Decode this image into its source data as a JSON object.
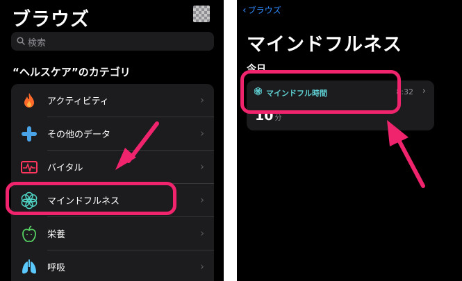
{
  "left": {
    "title": "ブラウズ",
    "search_placeholder": "検索",
    "section_header": "“ヘルスケア”のカテゴリ",
    "categories": [
      {
        "label": "アクティビティ",
        "icon": "flame-icon",
        "color": "#ff6a2a"
      },
      {
        "label": "その他のデータ",
        "icon": "plus-icon",
        "color": "#4aa3e6"
      },
      {
        "label": "バイタル",
        "icon": "heart-rate-icon",
        "color": "#ff375f"
      },
      {
        "label": "マインドフルネス",
        "icon": "mindfulness-icon",
        "color": "#4fd3c4"
      },
      {
        "label": "栄養",
        "icon": "apple-icon",
        "color": "#56d364"
      },
      {
        "label": "呼吸",
        "icon": "lungs-icon",
        "color": "#5ac8fa"
      }
    ]
  },
  "right": {
    "back_label": "ブラウズ",
    "title": "マインドフルネス",
    "section": "今日",
    "card": {
      "title": "マインドフル時間",
      "time": "8:32",
      "value": "10",
      "unit": "分"
    }
  },
  "colors": {
    "accent": "#2f8cff",
    "highlight": "#f0246d",
    "mindful": "#5ed0d3"
  }
}
